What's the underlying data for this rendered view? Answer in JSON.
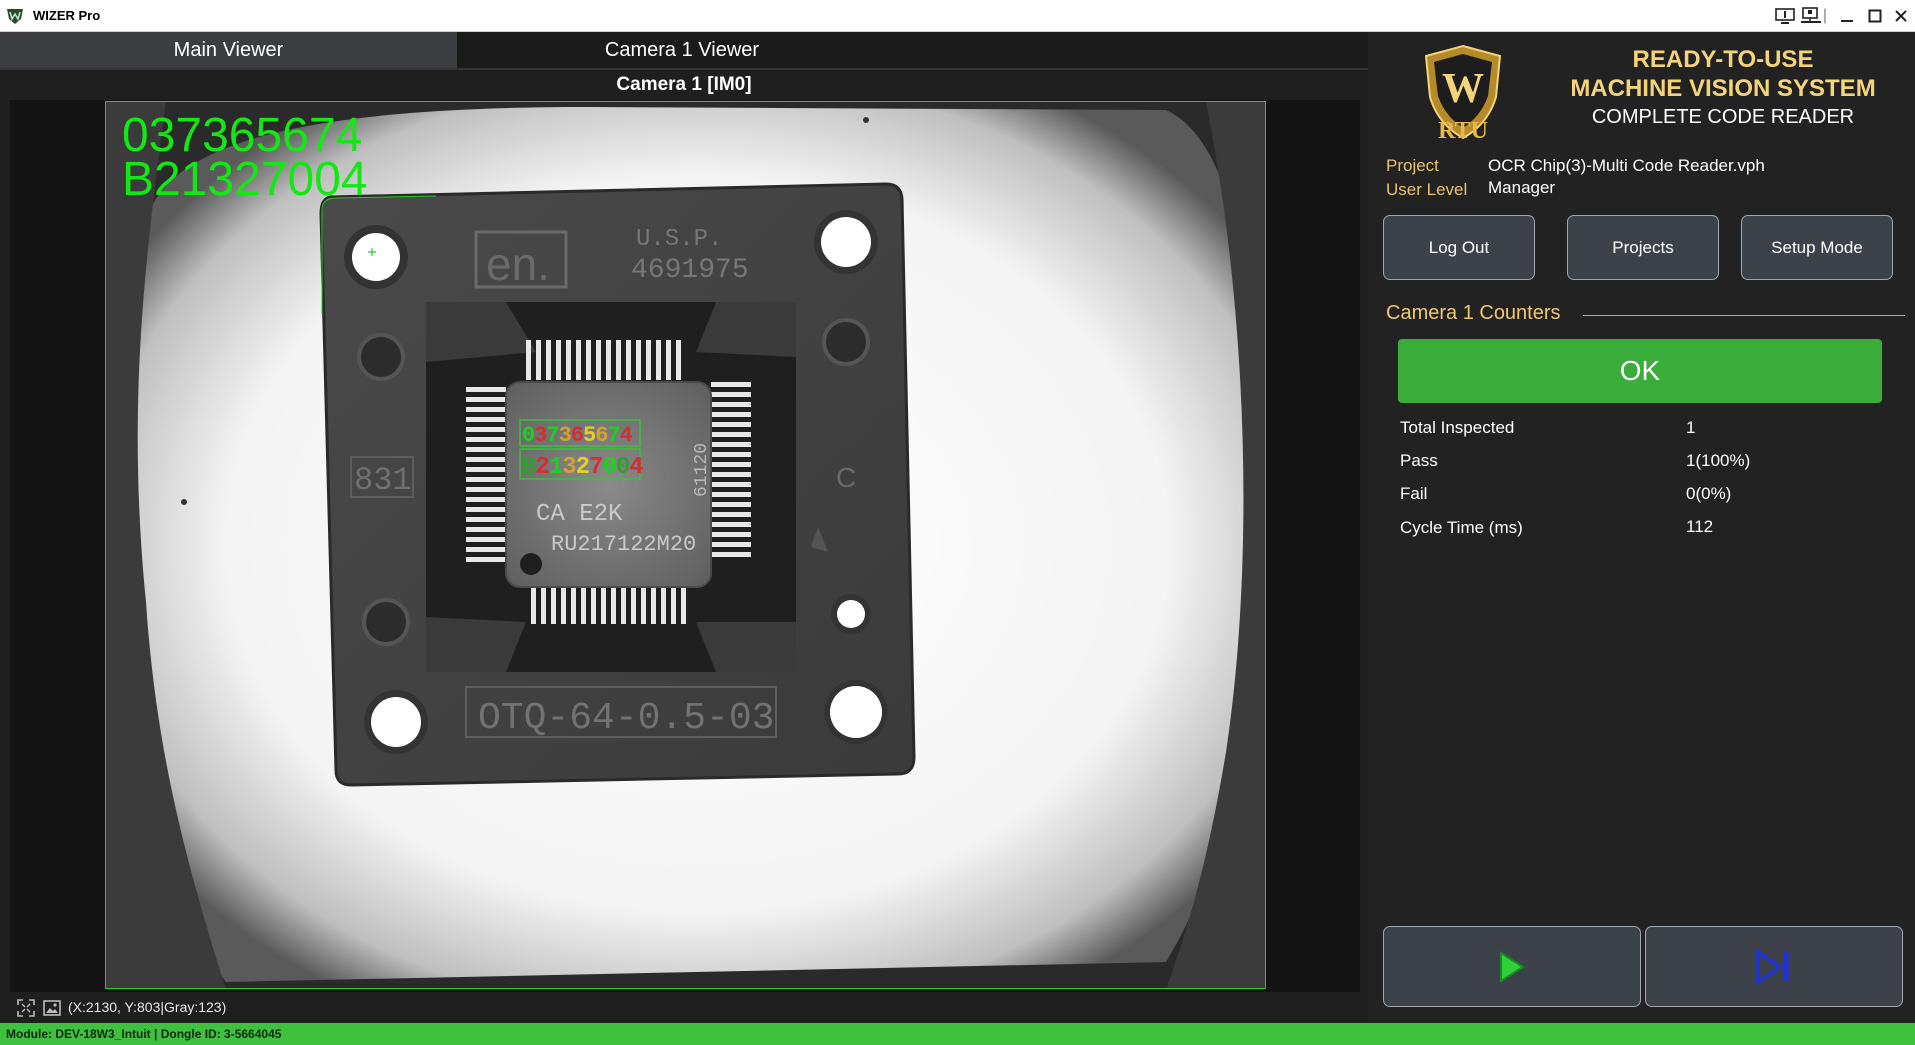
{
  "window": {
    "title": "WIZER Pro",
    "controls": [
      "monitor-icon",
      "network-icon",
      "minimize-icon",
      "maximize-icon",
      "close-icon"
    ]
  },
  "tabs": [
    {
      "label": "Main Viewer",
      "active": true
    },
    {
      "label": "Camera 1 Viewer",
      "active": false
    }
  ],
  "viewer": {
    "title": "Camera 1  [IM0]",
    "ocr_result": [
      "037365674",
      "B21327004"
    ],
    "coordinates": "(X:2130, Y:803|Gray:123)",
    "image_text": {
      "usp": "U.S.P.",
      "patent": "4691975",
      "socket_number": "831",
      "socket_model": "OTQ-64-0.5-03",
      "chip_line1": "CA  E2K",
      "chip_line2": "RU217122M20",
      "chip_side": "61120",
      "copyright": "C",
      "chip_ocr_line1": "037365674",
      "chip_ocr_line2": "B21327004"
    }
  },
  "status_bar": {
    "text": "Module: DEV-18W3_Intuit | Dongle ID: 3-5664045"
  },
  "brand": {
    "line1": "READY-TO-USE",
    "line2": "MACHINE VISION SYSTEM",
    "line3": "COMPLETE CODE READER",
    "logo_letters": "W",
    "logo_text": "RTU"
  },
  "info": {
    "project_label": "Project",
    "project_value": "OCR Chip(3)-Multi Code Reader.vph",
    "user_label": "User Level",
    "user_value": "Manager"
  },
  "buttons": {
    "logout": "Log Out",
    "projects": "Projects",
    "setup": "Setup Mode"
  },
  "counters": {
    "title": "Camera 1 Counters",
    "status": "OK",
    "rows": [
      {
        "label": "Total Inspected",
        "value": "1"
      },
      {
        "label": "Pass",
        "value": "1(100%)"
      },
      {
        "label": "Fail",
        "value": "0(0%)"
      },
      {
        "label": "Cycle Time (ms)",
        "value": "112"
      }
    ]
  },
  "colors": {
    "ok_green": "#3aad3a",
    "gold": "#f4d47b",
    "ocr_green": "#14e814",
    "play_green": "#2fd13a",
    "step_blue": "#1d34d8"
  }
}
